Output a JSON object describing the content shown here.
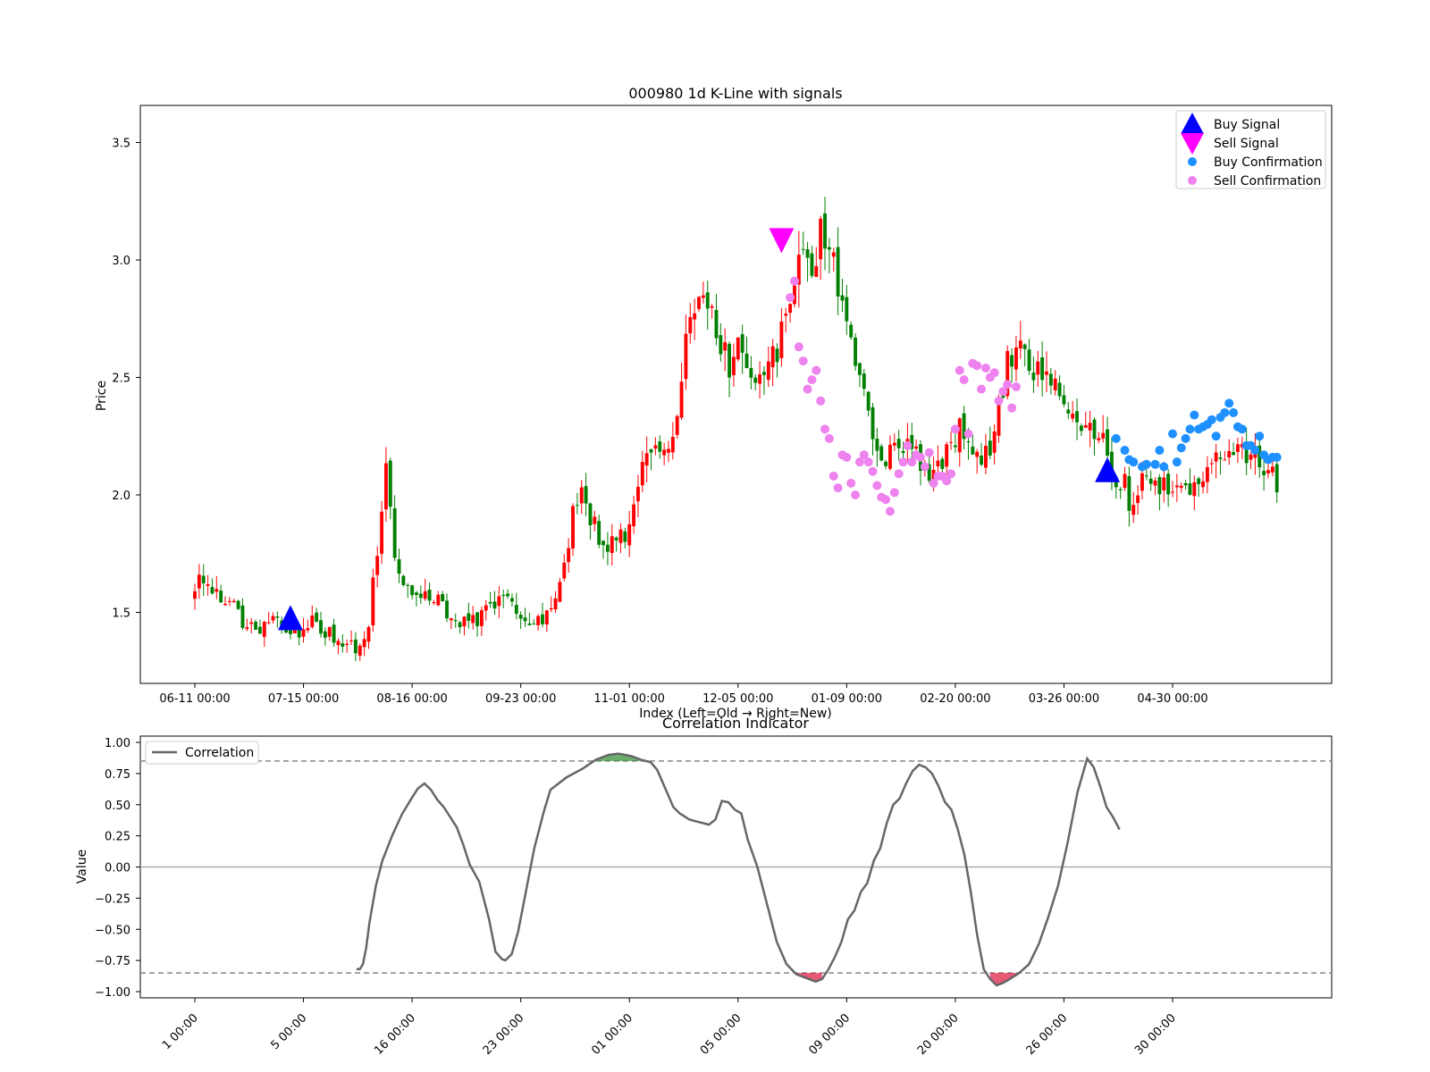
{
  "chart_data": [
    {
      "type": "candlestick",
      "title": "000980 1d K-Line with signals",
      "xlabel": "Index (Left=Old → Right=New)",
      "ylabel": "Price",
      "ylim": [
        1.2,
        3.65
      ],
      "yticks": [
        "1.5",
        "2.0",
        "2.5",
        "3.0",
        "3.5"
      ],
      "xticks": [
        "06-11 00:00",
        "07-15 00:00",
        "08-16 00:00",
        "09-23 00:00",
        "11-01 00:00",
        "12-05 00:00",
        "01-09 00:00",
        "02-20 00:00",
        "03-26 00:00",
        "04-30 00:00"
      ],
      "n_bars": 250,
      "up_color": "#ff0000",
      "down_color": "#008000",
      "price_path": [
        [
          0,
          1.63
        ],
        [
          5,
          1.62
        ],
        [
          8,
          1.58
        ],
        [
          12,
          1.52
        ],
        [
          18,
          1.43
        ],
        [
          22,
          1.44
        ],
        [
          27,
          1.48
        ],
        [
          33,
          1.4
        ],
        [
          37,
          1.47
        ],
        [
          43,
          1.41
        ],
        [
          48,
          1.36
        ],
        [
          52,
          1.34
        ],
        [
          56,
          1.46
        ],
        [
          59,
          1.78
        ],
        [
          62,
          2.18
        ],
        [
          64,
          1.8
        ],
        [
          68,
          1.6
        ],
        [
          74,
          1.6
        ],
        [
          78,
          1.56
        ],
        [
          82,
          1.5
        ],
        [
          85,
          1.44
        ],
        [
          90,
          1.46
        ],
        [
          95,
          1.51
        ],
        [
          100,
          1.58
        ],
        [
          105,
          1.5
        ],
        [
          110,
          1.46
        ],
        [
          113,
          1.47
        ],
        [
          117,
          1.56
        ],
        [
          120,
          1.72
        ],
        [
          122,
          1.92
        ],
        [
          125,
          2.01
        ],
        [
          128,
          1.88
        ],
        [
          132,
          1.8
        ],
        [
          136,
          1.79
        ],
        [
          140,
          1.86
        ],
        [
          144,
          2.1
        ],
        [
          148,
          2.24
        ],
        [
          152,
          2.15
        ],
        [
          156,
          2.38
        ],
        [
          160,
          2.8
        ],
        [
          164,
          2.85
        ],
        [
          168,
          2.72
        ],
        [
          172,
          2.55
        ],
        [
          176,
          2.68
        ],
        [
          180,
          2.5
        ],
        [
          184,
          2.58
        ],
        [
          188,
          2.62
        ],
        [
          192,
          2.8
        ],
        [
          196,
          3.08
        ],
        [
          200,
          2.98
        ],
        [
          202,
          3.17
        ],
        [
          204,
          2.95
        ],
        [
          206,
          3.02
        ],
        [
          209,
          2.78
        ],
        [
          212,
          2.6
        ],
        [
          215,
          2.45
        ],
        [
          218,
          2.3
        ],
        [
          221,
          2.18
        ],
        [
          225,
          2.17
        ],
        [
          229,
          2.22
        ],
        [
          233,
          2.15
        ],
        [
          237,
          2.1
        ],
        [
          240,
          2.1
        ],
        [
          243,
          2.18
        ],
        [
          246,
          2.28
        ],
        [
          250,
          2.22
        ],
        [
          254,
          2.15
        ],
        [
          258,
          2.26
        ],
        [
          262,
          2.58
        ],
        [
          266,
          2.62
        ],
        [
          270,
          2.52
        ],
        [
          274,
          2.56
        ],
        [
          278,
          2.48
        ],
        [
          282,
          2.38
        ],
        [
          286,
          2.3
        ],
        [
          290,
          2.28
        ],
        [
          294,
          2.22
        ],
        [
          297,
          2.06
        ],
        [
          300,
          2.05
        ],
        [
          302,
          1.9
        ],
        [
          305,
          2.05
        ],
        [
          309,
          2.07
        ],
        [
          313,
          2.03
        ],
        [
          317,
          2.06
        ],
        [
          321,
          2.02
        ],
        [
          325,
          2.1
        ],
        [
          329,
          2.17
        ],
        [
          333,
          2.2
        ],
        [
          337,
          2.17
        ],
        [
          341,
          2.17
        ],
        [
          345,
          2.12
        ],
        [
          349,
          2.06
        ]
      ],
      "buy_signals": [
        {
          "i": 22,
          "price": 1.47
        },
        {
          "i": 210,
          "price": 2.1
        }
      ],
      "sell_signals": [
        {
          "i": 135,
          "price": 3.09
        }
      ],
      "buy_confirmations": [
        [
          212,
          2.24
        ],
        [
          214,
          2.19
        ],
        [
          215,
          2.15
        ],
        [
          216,
          2.14
        ],
        [
          218,
          2.12
        ],
        [
          219,
          2.13
        ],
        [
          221,
          2.13
        ],
        [
          222,
          2.19
        ],
        [
          223,
          2.12
        ],
        [
          225,
          2.26
        ],
        [
          226,
          2.14
        ],
        [
          227,
          2.2
        ],
        [
          228,
          2.24
        ],
        [
          229,
          2.28
        ],
        [
          230,
          2.34
        ],
        [
          231,
          2.28
        ],
        [
          232,
          2.29
        ],
        [
          233,
          2.3
        ],
        [
          234,
          2.32
        ],
        [
          235,
          2.25
        ],
        [
          236,
          2.33
        ],
        [
          237,
          2.35
        ],
        [
          238,
          2.39
        ],
        [
          239,
          2.35
        ],
        [
          240,
          2.29
        ],
        [
          241,
          2.28
        ],
        [
          242,
          2.21
        ],
        [
          243,
          2.21
        ],
        [
          244,
          2.19
        ],
        [
          245,
          2.25
        ],
        [
          246,
          2.17
        ],
        [
          247,
          2.15
        ],
        [
          248,
          2.16
        ],
        [
          249,
          2.16
        ]
      ],
      "sell_confirmations": [
        [
          137,
          2.84
        ],
        [
          138,
          2.91
        ],
        [
          139,
          2.63
        ],
        [
          140,
          2.57
        ],
        [
          141,
          2.45
        ],
        [
          142,
          2.49
        ],
        [
          143,
          2.53
        ],
        [
          144,
          2.4
        ],
        [
          145,
          2.28
        ],
        [
          146,
          2.24
        ],
        [
          147,
          2.08
        ],
        [
          148,
          2.03
        ],
        [
          149,
          2.17
        ],
        [
          150,
          2.16
        ],
        [
          151,
          2.05
        ],
        [
          152,
          2.0
        ],
        [
          153,
          2.14
        ],
        [
          154,
          2.17
        ],
        [
          155,
          2.14
        ],
        [
          156,
          2.1
        ],
        [
          157,
          2.04
        ],
        [
          158,
          1.99
        ],
        [
          159,
          1.98
        ],
        [
          160,
          1.93
        ],
        [
          161,
          2.01
        ],
        [
          162,
          2.09
        ],
        [
          163,
          2.14
        ],
        [
          164,
          2.21
        ],
        [
          165,
          2.14
        ],
        [
          166,
          2.17
        ],
        [
          167,
          2.16
        ],
        [
          168,
          2.12
        ],
        [
          169,
          2.18
        ],
        [
          170,
          2.05
        ],
        [
          171,
          2.08
        ],
        [
          172,
          2.08
        ],
        [
          173,
          2.06
        ],
        [
          174,
          2.09
        ],
        [
          175,
          2.28
        ],
        [
          176,
          2.53
        ],
        [
          177,
          2.49
        ],
        [
          178,
          2.26
        ],
        [
          179,
          2.56
        ],
        [
          180,
          2.55
        ],
        [
          181,
          2.45
        ],
        [
          182,
          2.54
        ],
        [
          183,
          2.5
        ],
        [
          184,
          2.52
        ],
        [
          185,
          2.4
        ],
        [
          186,
          2.44
        ],
        [
          187,
          2.47
        ],
        [
          188,
          2.37
        ],
        [
          189,
          2.46
        ]
      ],
      "legend": {
        "placement": "top-right",
        "entries": [
          {
            "label": "Buy Signal",
            "marker": "triangle-up",
            "color": "#0000ff"
          },
          {
            "label": "Sell Signal",
            "marker": "triangle-down",
            "color": "#ff00ff"
          },
          {
            "label": "Buy Confirmation",
            "marker": "circle",
            "color": "#1e90ff"
          },
          {
            "label": "Sell Confirmation",
            "marker": "circle",
            "color": "#ee82ee"
          }
        ]
      }
    },
    {
      "type": "line",
      "title": "Correlation Indicator",
      "ylabel": "Value",
      "ylim": [
        -1.05,
        1.05
      ],
      "yticks": [
        "1.00",
        "0.75",
        "0.50",
        "0.25",
        "0.00",
        "−0.25",
        "−0.50",
        "−0.75",
        "−1.00"
      ],
      "xticks": [
        "1 00:00",
        "5 00:00",
        "16 00:00",
        "23 00:00",
        "01 00:00",
        "05 00:00",
        "09 00:00",
        "20 00:00",
        "26 00:00",
        "30 00:00"
      ],
      "thresholds": [
        0.85,
        -0.85
      ],
      "fill_colors": {
        "positive": "#2e8b2e",
        "negative": "#dc143c"
      },
      "line_color": "#666666",
      "legend": {
        "placement": "top-left",
        "entries": [
          {
            "label": "Correlation"
          }
        ]
      },
      "series": [
        {
          "name": "Correlation",
          "points": [
            [
              50,
              -0.82
            ],
            [
              51,
              -0.82
            ],
            [
              52,
              -0.78
            ],
            [
              53,
              -0.65
            ],
            [
              54,
              -0.45
            ],
            [
              56,
              -0.15
            ],
            [
              58,
              0.05
            ],
            [
              61,
              0.25
            ],
            [
              64,
              0.42
            ],
            [
              67,
              0.55
            ],
            [
              69,
              0.63
            ],
            [
              71,
              0.67
            ],
            [
              73,
              0.62
            ],
            [
              75,
              0.54
            ],
            [
              77,
              0.48
            ],
            [
              79,
              0.4
            ],
            [
              81,
              0.32
            ],
            [
              83,
              0.18
            ],
            [
              85,
              0.02
            ],
            [
              88,
              -0.12
            ],
            [
              91,
              -0.42
            ],
            [
              93,
              -0.68
            ],
            [
              95,
              -0.74
            ],
            [
              96,
              -0.75
            ],
            [
              98,
              -0.7
            ],
            [
              100,
              -0.52
            ],
            [
              102,
              -0.25
            ],
            [
              105,
              0.15
            ],
            [
              108,
              0.45
            ],
            [
              110,
              0.62
            ],
            [
              112,
              0.66
            ],
            [
              115,
              0.72
            ],
            [
              120,
              0.79
            ],
            [
              124,
              0.86
            ],
            [
              128,
              0.9
            ],
            [
              131,
              0.91
            ],
            [
              135,
              0.89
            ],
            [
              138,
              0.86
            ],
            [
              141,
              0.84
            ],
            [
              143,
              0.78
            ],
            [
              146,
              0.6
            ],
            [
              148,
              0.48
            ],
            [
              150,
              0.43
            ],
            [
              153,
              0.38
            ],
            [
              156,
              0.36
            ],
            [
              159,
              0.34
            ],
            [
              161,
              0.38
            ],
            [
              163,
              0.53
            ],
            [
              165,
              0.52
            ],
            [
              167,
              0.46
            ],
            [
              169,
              0.43
            ],
            [
              171,
              0.22
            ],
            [
              174,
              0.0
            ],
            [
              177,
              -0.3
            ],
            [
              180,
              -0.6
            ],
            [
              183,
              -0.78
            ],
            [
              186,
              -0.86
            ],
            [
              189,
              -0.89
            ],
            [
              192,
              -0.92
            ],
            [
              194,
              -0.9
            ],
            [
              196,
              -0.82
            ],
            [
              198,
              -0.72
            ],
            [
              200,
              -0.6
            ],
            [
              202,
              -0.42
            ],
            [
              204,
              -0.35
            ],
            [
              206,
              -0.2
            ],
            [
              208,
              -0.13
            ],
            [
              210,
              0.05
            ],
            [
              212,
              0.15
            ],
            [
              214,
              0.35
            ],
            [
              216,
              0.5
            ],
            [
              218,
              0.55
            ],
            [
              220,
              0.67
            ],
            [
              222,
              0.77
            ],
            [
              224,
              0.82
            ],
            [
              226,
              0.8
            ],
            [
              228,
              0.75
            ],
            [
              230,
              0.65
            ],
            [
              232,
              0.52
            ],
            [
              234,
              0.46
            ],
            [
              236,
              0.3
            ],
            [
              238,
              0.1
            ],
            [
              240,
              -0.2
            ],
            [
              242,
              -0.55
            ],
            [
              244,
              -0.82
            ],
            [
              246,
              -0.9
            ],
            [
              248,
              -0.95
            ],
            [
              250,
              -0.93
            ],
            [
              252,
              -0.9
            ],
            [
              255,
              -0.85
            ],
            [
              258,
              -0.78
            ],
            [
              261,
              -0.62
            ],
            [
              264,
              -0.4
            ],
            [
              267,
              -0.15
            ],
            [
              270,
              0.2
            ],
            [
              273,
              0.6
            ],
            [
              276,
              0.87
            ],
            [
              278,
              0.8
            ],
            [
              280,
              0.65
            ],
            [
              282,
              0.48
            ],
            [
              284,
              0.4
            ],
            [
              286,
              0.3
            ]
          ]
        }
      ]
    }
  ]
}
